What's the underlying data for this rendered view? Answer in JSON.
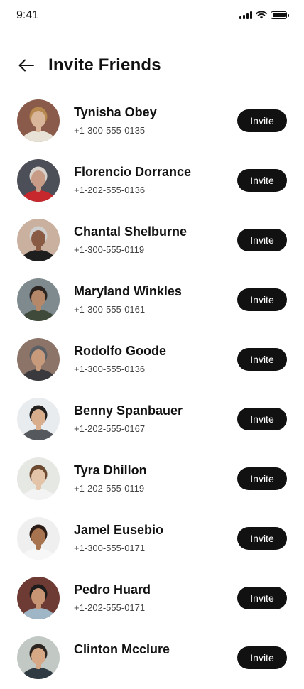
{
  "status_bar": {
    "time": "9:41"
  },
  "header": {
    "title": "Invite Friends",
    "back_icon": "arrow-left-icon"
  },
  "contacts": [
    {
      "name": "Tynisha Obey",
      "phone": "+1-300-555-0135",
      "action": "Invite",
      "colors": {
        "bg": "#8a5a4a",
        "skin": "#d9b59a",
        "hair": "#b8894f",
        "shirt": "#e8e2d6"
      }
    },
    {
      "name": "Florencio Dorrance",
      "phone": "+1-202-555-0136",
      "action": "Invite",
      "colors": {
        "bg": "#4c4f57",
        "skin": "#c89b86",
        "hair": "#d8d2cc",
        "shirt": "#c7282e"
      }
    },
    {
      "name": "Chantal Shelburne",
      "phone": "+1-300-555-0119",
      "action": "Invite",
      "colors": {
        "bg": "#c9b09f",
        "skin": "#8a5b44",
        "hair": "#cfcfcf",
        "shirt": "#1e1e1e"
      }
    },
    {
      "name": "Maryland Winkles",
      "phone": "+1-300-555-0161",
      "action": "Invite",
      "colors": {
        "bg": "#7e8a8e",
        "skin": "#b58869",
        "hair": "#2a2320",
        "shirt": "#3f4a3a"
      }
    },
    {
      "name": "Rodolfo Goode",
      "phone": "+1-300-555-0136",
      "action": "Invite",
      "colors": {
        "bg": "#8d7468",
        "skin": "#c79a7b",
        "hair": "#5a5f66",
        "shirt": "#3a3a3e"
      }
    },
    {
      "name": "Benny Spanbauer",
      "phone": "+1-202-555-0167",
      "action": "Invite",
      "colors": {
        "bg": "#e9ecef",
        "skin": "#d8ae8c",
        "hair": "#22201f",
        "shirt": "#55585d"
      }
    },
    {
      "name": "Tyra Dhillon",
      "phone": "+1-202-555-0119",
      "action": "Invite",
      "colors": {
        "bg": "#e6e8e4",
        "skin": "#e3c4a8",
        "hair": "#6b4a30",
        "shirt": "#f3f3f3"
      }
    },
    {
      "name": "Jamel Eusebio",
      "phone": "+1-300-555-0171",
      "action": "Invite",
      "colors": {
        "bg": "#efefef",
        "skin": "#a8744f",
        "hair": "#2b1d15",
        "shirt": "#f7f7f7"
      }
    },
    {
      "name": "Pedro Huard",
      "phone": "+1-202-555-0171",
      "action": "Invite",
      "colors": {
        "bg": "#6e3a34",
        "skin": "#c79474",
        "hair": "#1c1c1c",
        "shirt": "#9fb6c6"
      }
    },
    {
      "name": "Clinton Mcclure",
      "phone": "",
      "action": "Invite",
      "colors": {
        "bg": "#c2c8c4",
        "skin": "#d6a885",
        "hair": "#2c2522",
        "shirt": "#2f3a42"
      }
    }
  ]
}
